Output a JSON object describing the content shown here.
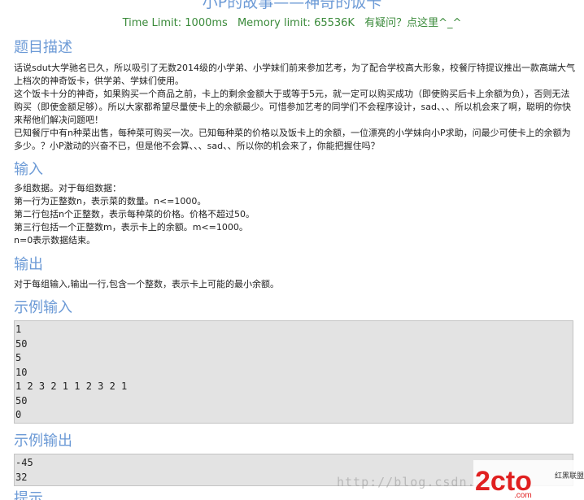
{
  "problem": {
    "title": "小P的故事——神奇的饭卡",
    "time_limit": "Time Limit: 1000ms",
    "memory_limit": "Memory limit: 65536K",
    "ask_link": "有疑问？点这里^_^"
  },
  "sections": {
    "description": {
      "heading": "题目描述",
      "paragraphs": [
        " 话说sdut大学驰名已久，所以吸引了无数2014级的小学弟、小学妹们前来参加艺考，为了配合学校高大形象，校餐厅特提议推出一款高端大气上档次的神奇饭卡，供学弟、学妹们使用。",
        "    这个饭卡十分的神奇，如果购买一个商品之前，卡上的剩余金额大于或等于5元，就一定可以购买成功（即使购买后卡上余额为负），否则无法购买（即使金额足够）。所以大家都希望尽量使卡上的余额最少。可惜参加艺考的同学们不会程序设计，sad、、、所以机会来了啊，聪明的你快来帮他们解决问题吧！",
        "已知餐厅中有n种菜出售，每种菜可购买一次。已知每种菜的价格以及饭卡上的余额，一位漂亮的小学妹向小P求助，问最少可使卡上的余额为多少。？小P激动的兴奋不已，但是他不会算、、、sad、、所以你的机会来了，你能把握住吗？"
      ]
    },
    "input": {
      "heading": "输入",
      "lines": [
        " 多组数据。对于每组数据：",
        "第一行为正整数n，表示菜的数量。n<=1000。",
        "第二行包括n个正整数，表示每种菜的价格。价格不超过50。",
        "第三行包括一个正整数m，表示卡上的余额。m<=1000。",
        "n=0表示数据结束。"
      ]
    },
    "output": {
      "heading": "输出",
      "lines": [
        " 对于每组输入,输出一行,包含一个整数，表示卡上可能的最小余额。"
      ]
    },
    "sample_input": {
      "heading": "示例输入",
      "lines": [
        "1",
        "50",
        "5",
        "10",
        "1 2 3 2 1 1 2 3 2 1",
        "50",
        "0"
      ]
    },
    "sample_output": {
      "heading": "示例输出",
      "lines": [
        "-45",
        "32"
      ]
    },
    "hint": {
      "heading": "提示"
    }
  },
  "watermark": {
    "url": "http://blog.csdn.net/",
    "logo_text": "2cto",
    "logo_suffix": ".com",
    "logo_side": "红黑联盟"
  },
  "colors": {
    "heading": "#6c9ad6",
    "limits": "#3a8a3a",
    "code_bg": "#e3e3e3",
    "logo_red": "#e02020"
  }
}
